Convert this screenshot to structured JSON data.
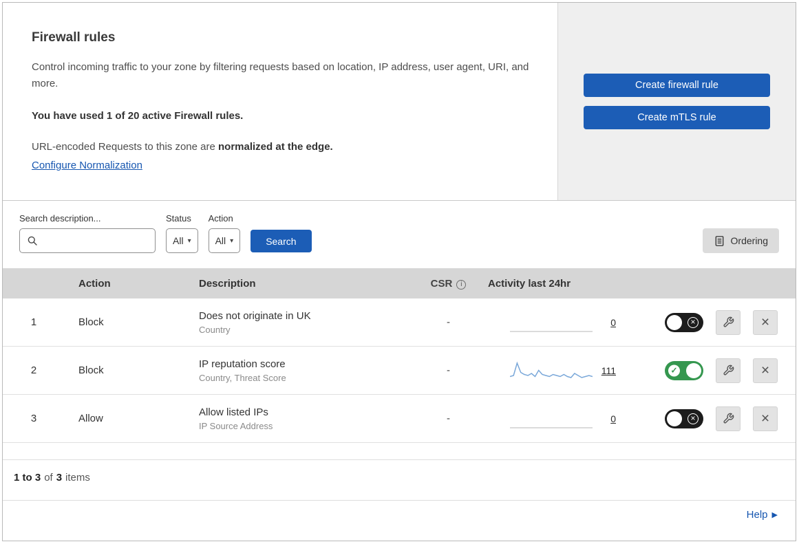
{
  "panel": {
    "title": "Firewall rules",
    "description": "Control incoming traffic to your zone by filtering requests based on location, IP address, user agent, URI, and more.",
    "usage": "You have used 1 of 20 active Firewall rules.",
    "normalization": {
      "prefix": "URL-encoded Requests to this zone are",
      "bold": "normalized at the edge.",
      "link": "Configure Normalization"
    },
    "actions": {
      "create_firewall": "Create firewall rule",
      "create_mtls": "Create mTLS rule"
    }
  },
  "filters": {
    "search_label": "Search description...",
    "status": {
      "label": "Status",
      "value": "All"
    },
    "action": {
      "label": "Action",
      "value": "All"
    },
    "search_button": "Search",
    "ordering_button": "Ordering"
  },
  "table": {
    "headers": {
      "action": "Action",
      "description": "Description",
      "csr": "CSR",
      "activity": "Activity last 24hr"
    },
    "rows": [
      {
        "priority": "1",
        "action": "Block",
        "description": "Does not originate in UK",
        "criteria": "Country",
        "csr": "-",
        "activity_count": "0",
        "enabled": false,
        "sparkline": [
          0,
          0,
          0,
          0,
          0,
          0,
          0,
          0,
          0,
          0,
          0,
          0
        ]
      },
      {
        "priority": "2",
        "action": "Block",
        "description": "IP reputation score",
        "criteria": "Country, Threat Score",
        "csr": "-",
        "activity_count": "111",
        "enabled": true,
        "sparkline": [
          3,
          4,
          16,
          7,
          5,
          4,
          6,
          3,
          9,
          5,
          4,
          3,
          5,
          4,
          3,
          5,
          3,
          2,
          6,
          4,
          2,
          3,
          4,
          3
        ]
      },
      {
        "priority": "3",
        "action": "Allow",
        "description": "Allow listed IPs",
        "criteria": "IP Source Address",
        "csr": "-",
        "activity_count": "0",
        "enabled": false,
        "sparkline": [
          0,
          0,
          0,
          0,
          0,
          0,
          0,
          0,
          0,
          0,
          0,
          0
        ]
      }
    ]
  },
  "footer": {
    "range": "1 to 3",
    "of": "of",
    "total": "3",
    "items": "items"
  },
  "help": "Help",
  "colors": {
    "accent_blue": "#1c5db6",
    "link_blue": "#1656b0",
    "toggle_green": "#35974f",
    "table_header_gray": "#d6d6d6",
    "panel_gray": "#efefef"
  }
}
